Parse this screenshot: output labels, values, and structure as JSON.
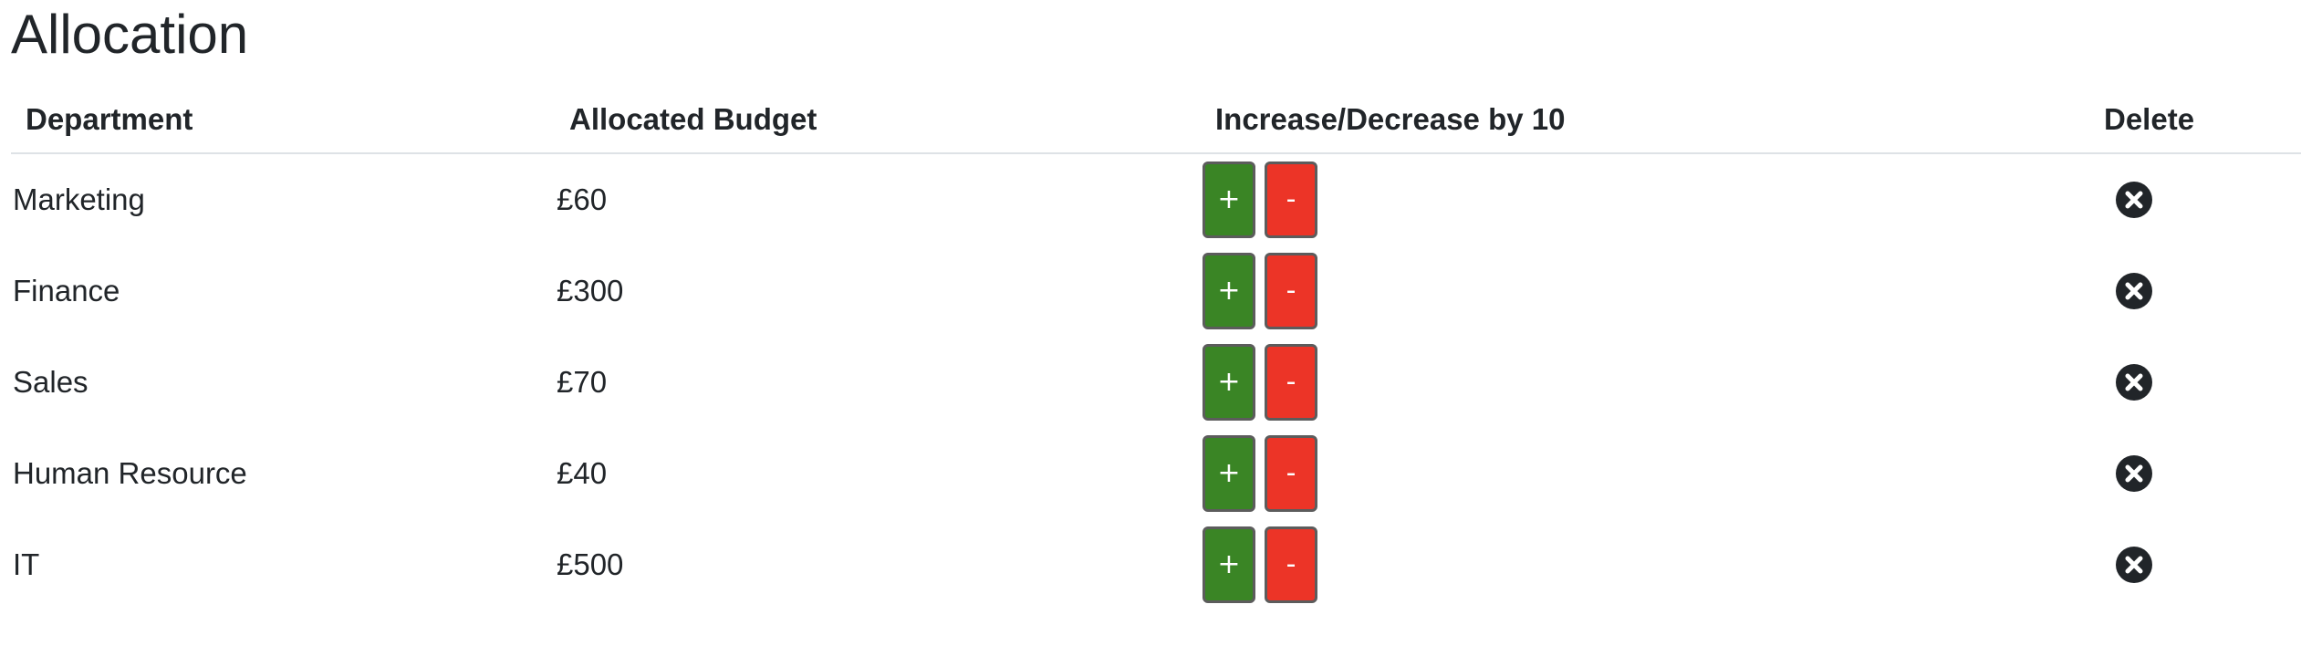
{
  "page": {
    "title": "Allocation"
  },
  "table": {
    "headers": {
      "department": "Department",
      "budget": "Allocated Budget",
      "change": "Increase/Decrease by 10",
      "delete": "Delete"
    },
    "rows": [
      {
        "department": "Marketing",
        "budget": "£60",
        "increase_label": "+",
        "decrease_label": "-"
      },
      {
        "department": "Finance",
        "budget": "£300",
        "increase_label": "+",
        "decrease_label": "-"
      },
      {
        "department": "Sales",
        "budget": "£70",
        "increase_label": "+",
        "decrease_label": "-"
      },
      {
        "department": "Human Resource",
        "budget": "£40",
        "increase_label": "+",
        "decrease_label": "-"
      },
      {
        "department": "IT",
        "budget": "£500",
        "increase_label": "+",
        "decrease_label": "-"
      }
    ]
  },
  "icons": {
    "delete": "x-circle-icon"
  },
  "colors": {
    "increase": "#3a8525",
    "decrease": "#ec3427",
    "text": "#212529",
    "delete_icon": "#212529",
    "divider": "#dee2e6"
  }
}
